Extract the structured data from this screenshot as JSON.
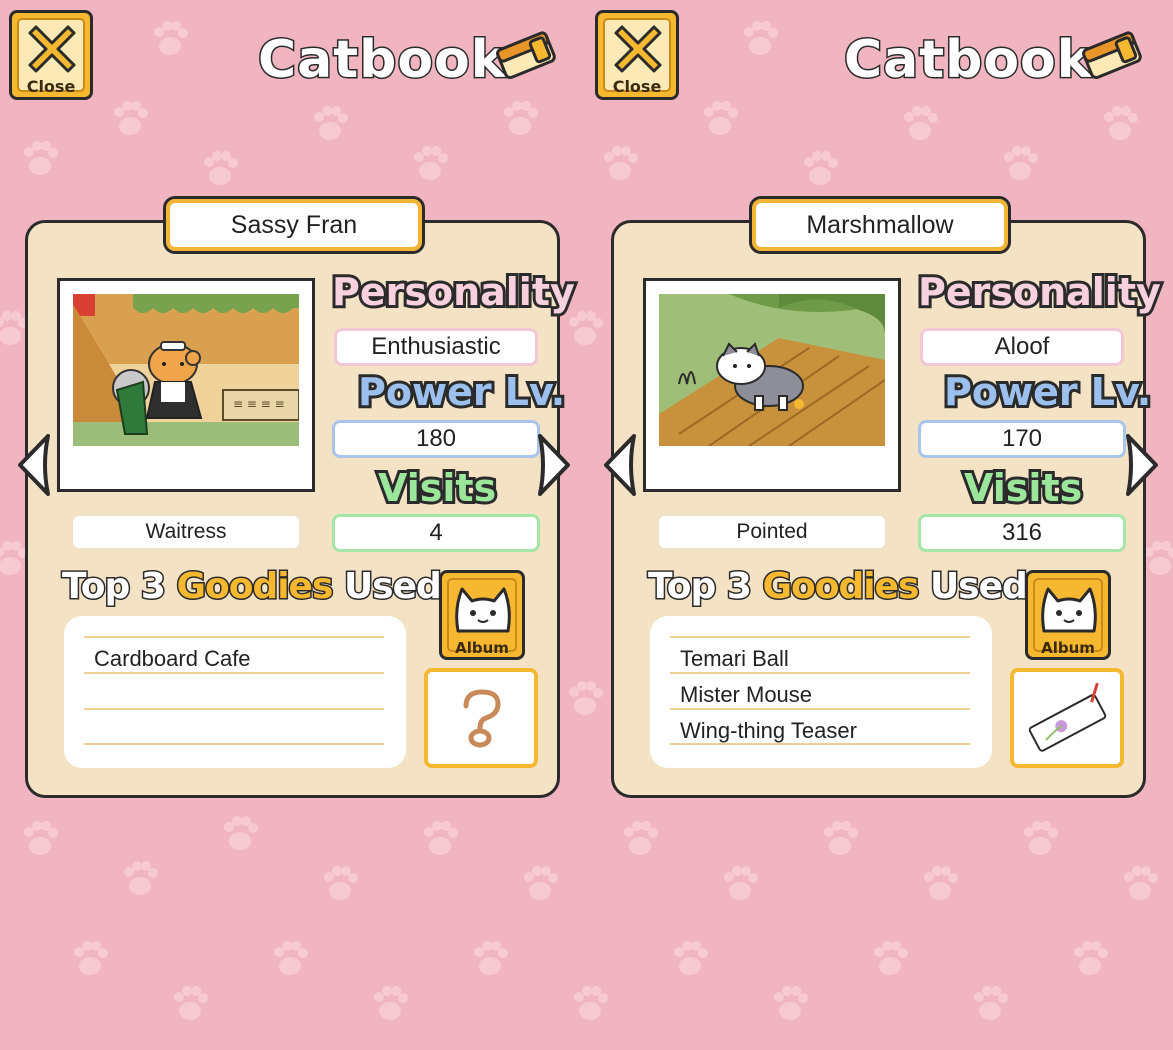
{
  "background_color": "#f1b5c1",
  "panels": [
    {
      "header": {
        "title": "Catbook",
        "close_label": "Close"
      },
      "cat_name": "Sassy Fran",
      "photo_icon": "maid-cat-photo",
      "personality_label": "Personality",
      "personality": "Enthusiastic",
      "power_label": "Power Lv.",
      "power_level": "180",
      "visits_label": "Visits",
      "visits": "4",
      "coat": "Waitress",
      "goodies_title": {
        "a": "Top",
        "b": "3",
        "c": "Goodies",
        "d": "Used"
      },
      "goodies": [
        "Cardboard Cafe",
        "",
        ""
      ],
      "album_label": "Album",
      "memento_icon": "question-mark-icon"
    },
    {
      "header": {
        "title": "Catbook",
        "close_label": "Close"
      },
      "cat_name": "Marshmallow",
      "photo_icon": "white-cat-on-mat-photo",
      "personality_label": "Personality",
      "personality": "Aloof",
      "power_label": "Power Lv.",
      "power_level": "170",
      "visits_label": "Visits",
      "visits": "316",
      "coat": "Pointed",
      "goodies_title": {
        "a": "Top",
        "b": "3",
        "c": "Goodies",
        "d": "Used"
      },
      "goodies": [
        "Temari Ball",
        "Mister Mouse",
        "Wing-thing Teaser"
      ],
      "album_label": "Album",
      "memento_icon": "bookmark-memento-icon"
    }
  ],
  "colors": {
    "gold": "#f6b830",
    "card": "#f3e2c4",
    "pink_label": "#eda6bf",
    "blue_label": "#7fa8e0",
    "green_label": "#7ed87e"
  }
}
